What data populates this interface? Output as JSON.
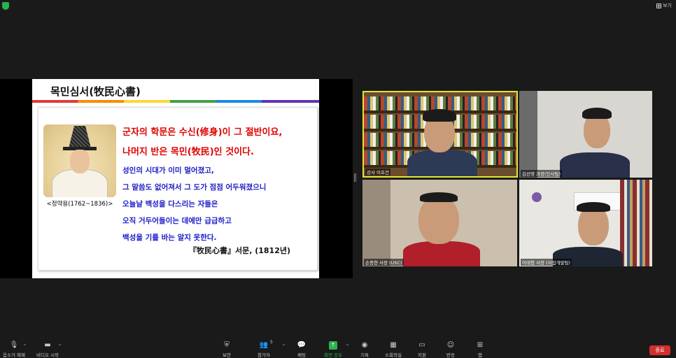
{
  "topbar": {
    "view_label": "보기"
  },
  "slide": {
    "title": "목민심서(牧民心書)",
    "portrait_caption": "<정약용(1762~1836)>",
    "red_lines": [
      "군자의 학문은 수신(修身)이 그 절반이요,",
      "나머지 반은 목민(牧民)인 것이다."
    ],
    "blue_lines": [
      "성인의 시대가 이미 멀어졌고,",
      "그 말씀도 없어져서 그 도가 점점 어두워졌으니",
      "오늘날 백성을 다스리는 자들은",
      "오직 거두어들이는 데에만 급급하고",
      "백성을 기를 바는 알지 못한다."
    ],
    "source": "『牧民心書』서문, (1812년)",
    "colors": {
      "red": "#e00000",
      "blue": "#1a1ac8"
    }
  },
  "participants": [
    {
      "name": "강사 이호건",
      "active_speaker": true
    },
    {
      "name": "김선영 과장(인사팀)"
    },
    {
      "name": "손종현 사장 (USC)"
    },
    {
      "name": "이태형 사장 (사업개발팀)"
    }
  ],
  "toolbar": {
    "mute": "음소거 해제",
    "video": "비디오 시작",
    "security": "보안",
    "participants": "참가자",
    "participants_count": "5",
    "chat": "채팅",
    "share": "화면 공유",
    "record": "기록",
    "breakout": "소회의실",
    "support": "지원",
    "reactions": "반응",
    "apps": "앱",
    "end": "종료"
  }
}
